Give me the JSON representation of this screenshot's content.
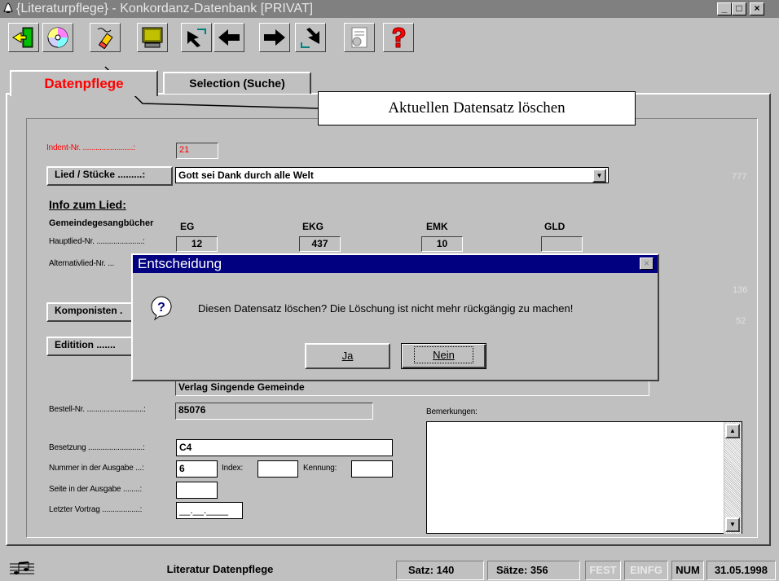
{
  "window": {
    "title": "{Literaturpflege} -   Konkordanz-Datenbank [PRIVAT]",
    "minimize": "_",
    "maximize": "□",
    "close": "×"
  },
  "toolbar": {
    "icons": [
      "exit-icon",
      "cd-icon",
      "eraser-icon",
      "monitor-icon",
      "first-record-icon",
      "previous-record-icon",
      "next-record-icon",
      "last-record-icon",
      "report-icon",
      "help-icon"
    ]
  },
  "tabs": {
    "active": "Datenpflege",
    "inactive": "Selection (Suche)"
  },
  "tooltip": "Aktuellen Datensatz löschen",
  "form": {
    "ident_label": "Indent-Nr. ........................:",
    "ident_value": "21",
    "lied_button": "Lied / Stücke .........:",
    "lied_value": "Gott sei Dank durch alle Welt",
    "side_num_1": "777",
    "info_heading": "Info zum Lied:",
    "gemeinde_label": "Gemeindegesangbücher",
    "col_headers": [
      "EG",
      "EKG",
      "EMK",
      "GLD"
    ],
    "hauptlied_label": "Hauptlied-Nr. ......................:",
    "hauptlied_values": [
      "12",
      "437",
      "10",
      ""
    ],
    "alternativ_label": "Alternativlied-Nr. ...",
    "side_num_2": "136",
    "komponisten_button": "Komponisten .",
    "side_num_3": "52",
    "edition_button": "Editition .......",
    "verlag_value": "Verlag Singende Gemeinde",
    "bestell_label": "Bestell-Nr. ...........................:",
    "bestell_value": "85076",
    "bemerkungen_label": "Bemerkungen:",
    "besetzung_label": "Besetzung ..........................:",
    "besetzung_value": "C4",
    "nummer_label": "Nummer in der Ausgabe ...:",
    "nummer_value": "6",
    "index_label": "Index:",
    "index_value": "",
    "kennung_label": "Kennung:",
    "kennung_value": "",
    "seite_label": "Seite in der Ausgabe ........:",
    "seite_value": "",
    "letzter_label": "Letzter Vortrag ..................:",
    "letzter_value": "__.__.____"
  },
  "dialog": {
    "title": "Entscheidung",
    "message": "Diesen Datensatz löschen? Die Löschung ist nicht mehr rückgängig zu machen!",
    "icon": "question-icon",
    "yes_button": "Ja",
    "no_button": "Nein",
    "close": "×"
  },
  "statusbar": {
    "app_label": "Literatur Datenpflege",
    "satz": "Satz: 140",
    "saetze": "Sätze: 356",
    "fest": "FEST",
    "einfg": "EINFG",
    "num": "NUM",
    "date": "31.05.1998"
  }
}
